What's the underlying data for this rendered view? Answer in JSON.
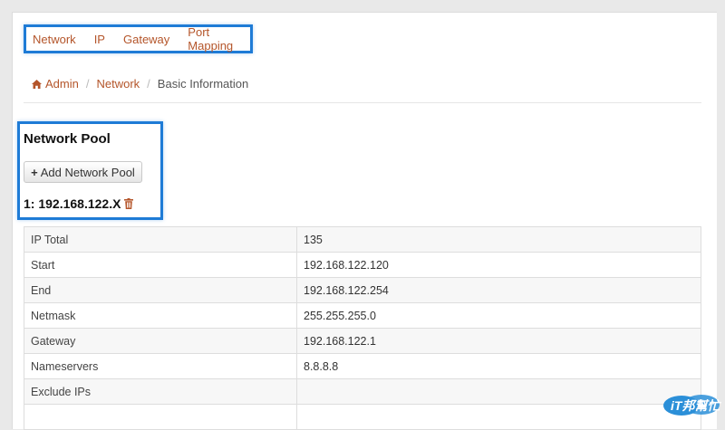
{
  "nav": {
    "items": [
      "Network",
      "IP",
      "Gateway",
      "Port Mapping"
    ]
  },
  "breadcrumb": {
    "home": "Admin",
    "section": "Network",
    "current": "Basic Information"
  },
  "pool": {
    "title": "Network Pool",
    "add_label": "Add Network Pool",
    "entry": "1: 192.168.122.X"
  },
  "table": {
    "rows": [
      {
        "key": "IP Total",
        "value": "135"
      },
      {
        "key": "Start",
        "value": "192.168.122.120"
      },
      {
        "key": "End",
        "value": "192.168.122.254"
      },
      {
        "key": "Netmask",
        "value": "255.255.255.0"
      },
      {
        "key": "Gateway",
        "value": "192.168.122.1"
      },
      {
        "key": "Nameservers",
        "value": "8.8.8.8"
      },
      {
        "key": "Exclude IPs",
        "value": ""
      }
    ]
  },
  "watermark": {
    "text": "iT邦幫忙"
  },
  "colors": {
    "link": "#b4552a",
    "highlight": "#1e7bd6",
    "table_stripe": "#f7f7f7"
  },
  "icons": {
    "home": "home-icon",
    "trash": "trash-icon",
    "plus": "plus-icon"
  }
}
